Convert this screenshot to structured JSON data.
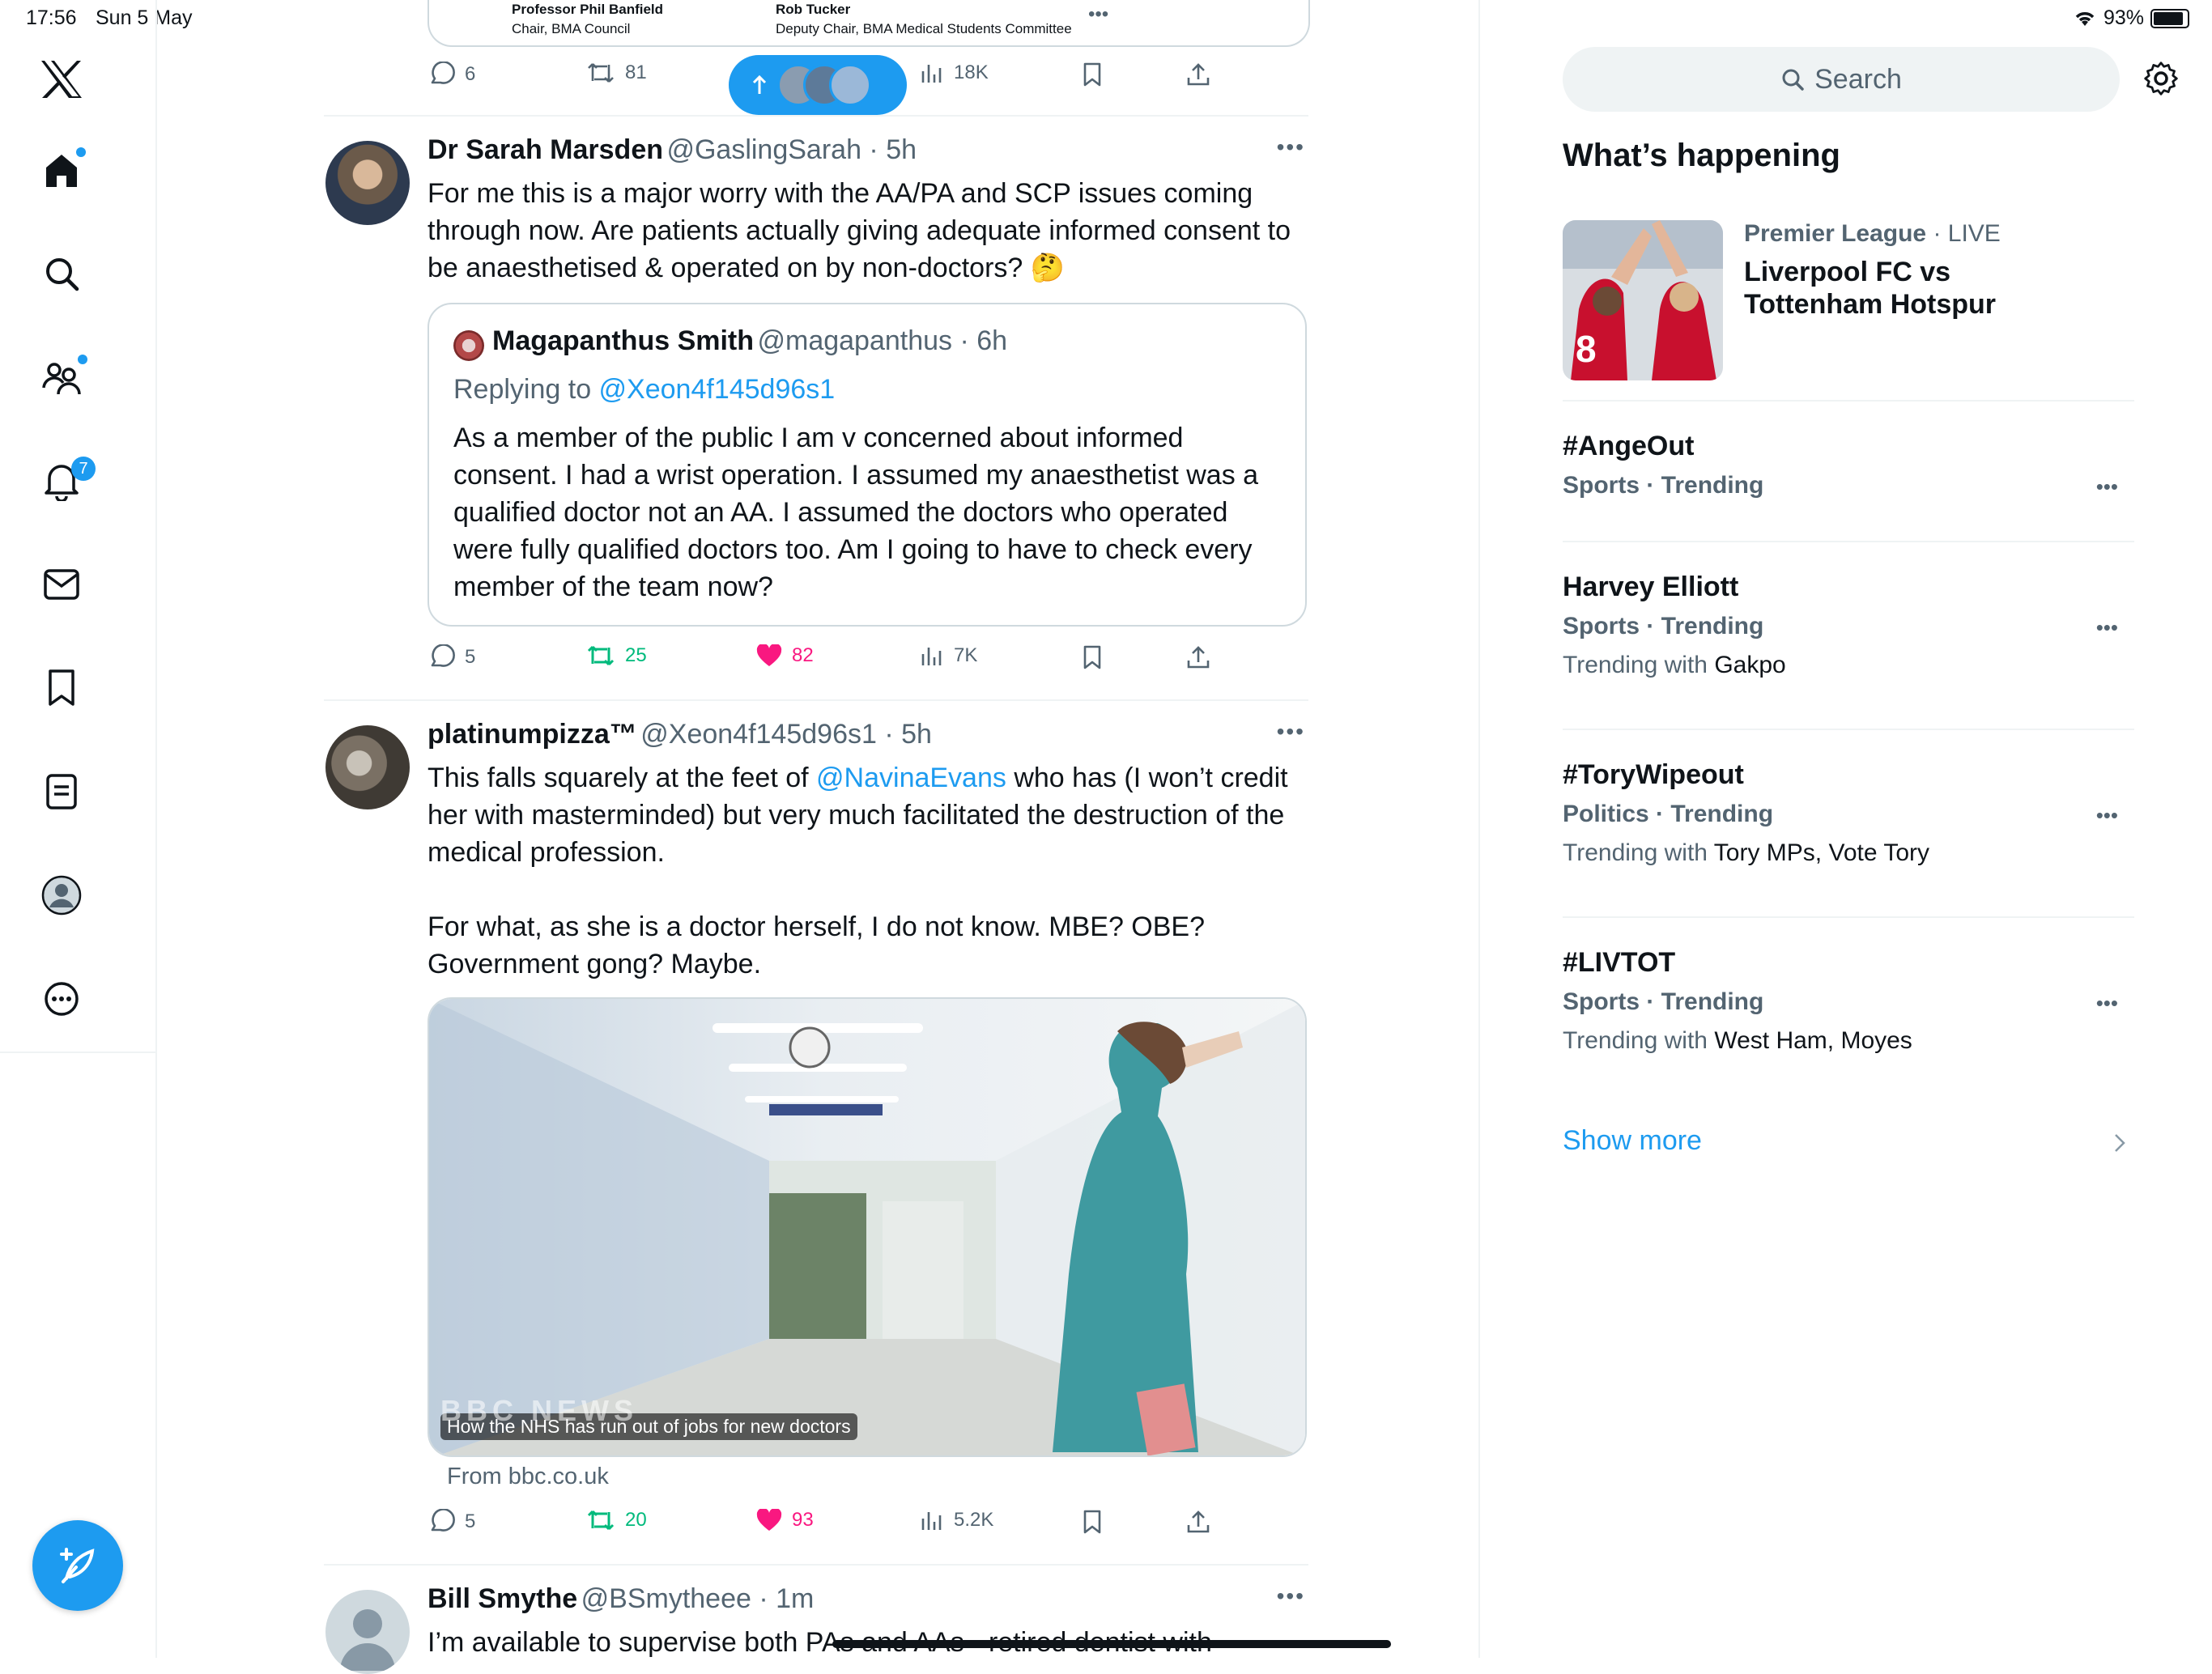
{
  "status": {
    "time": "17:56",
    "date": "Sun 5 May",
    "battery": "93%"
  },
  "nav": {
    "notifications_badge": "7"
  },
  "colors": {
    "accent": "#1d9bf0",
    "like": "#f91880",
    "retweet": "#00ba7c",
    "text": "#0f1419",
    "muted": "#536471"
  },
  "top_tweet": {
    "caption_left_name": "Professor Phil Banfield",
    "caption_left_role": "Chair, BMA Council",
    "caption_right_name": "Rob Tucker",
    "caption_right_role": "Deputy Chair, BMA Medical Students Committee",
    "replies": "6",
    "retweets": "81",
    "views": "18K"
  },
  "tweets": [
    {
      "name": "Dr Sarah Marsden",
      "handle": "@GaslingSarah",
      "time": "5h",
      "text": "For me this is a major worry with the AA/PA and SCP issues coming through now. Are patients actually giving adequate informed consent to be anaesthetised & operated on by non-doctors? 🤔",
      "quote": {
        "name": "Magapanthus Smith",
        "handle": "@magapanthus",
        "time": "6h",
        "replying_prefix": "Replying to ",
        "replying_to": "@Xeon4f145d96s1",
        "text": "As a member of the public I am v concerned about informed consent. I had a wrist operation. I assumed my anaesthetist was a qualified  doctor not an AA. I assumed the doctors who operated were fully qualified doctors too. Am I going to have to check every member of the team now?"
      },
      "replies": "5",
      "retweets": "25",
      "likes": "82",
      "views": "7K"
    },
    {
      "name": "platinumpizza™",
      "handle": "@Xeon4f145d96s1",
      "time": "5h",
      "text_before": "This falls squarely at the feet of ",
      "mention": "@NavinaEvans",
      "text_after": " who has (I won’t credit her with masterminded) but very much facilitated the destruction of the medical profession.",
      "text_para2": "For what, as she is a doctor herself, I do not know. MBE? OBE? Government gong? Maybe.",
      "card_caption": "How the NHS has run out of jobs for new doctors",
      "card_watermark": "BBC NEWS",
      "card_source": "From bbc.co.uk",
      "replies": "5",
      "retweets": "20",
      "likes": "93",
      "views": "5.2K"
    },
    {
      "name": "Bill Smythe",
      "handle": "@BSmytheee",
      "time": "1m",
      "text": "I’m available to supervise both PAs and AAs - retired dentist with"
    }
  ],
  "sidebar": {
    "search_placeholder": "Search",
    "heading": "What’s happening",
    "featured": {
      "category": "Premier League",
      "status": "LIVE",
      "title": "Liverpool FC vs Tottenham Hotspur"
    },
    "trends": [
      {
        "title": "#AngeOut",
        "meta": "Sports · Trending",
        "with_prefix": "",
        "with": ""
      },
      {
        "title": "Harvey Elliott",
        "meta": "Sports · Trending",
        "with_prefix": "Trending with ",
        "with": "Gakpo"
      },
      {
        "title": "#ToryWipeout",
        "meta": "Politics · Trending",
        "with_prefix": "Trending with ",
        "with": "Tory MPs, Vote Tory"
      },
      {
        "title": "#LIVTOT",
        "meta": "Sports · Trending",
        "with_prefix": "Trending with ",
        "with": "West Ham, Moyes"
      }
    ],
    "show_more": "Show more"
  }
}
